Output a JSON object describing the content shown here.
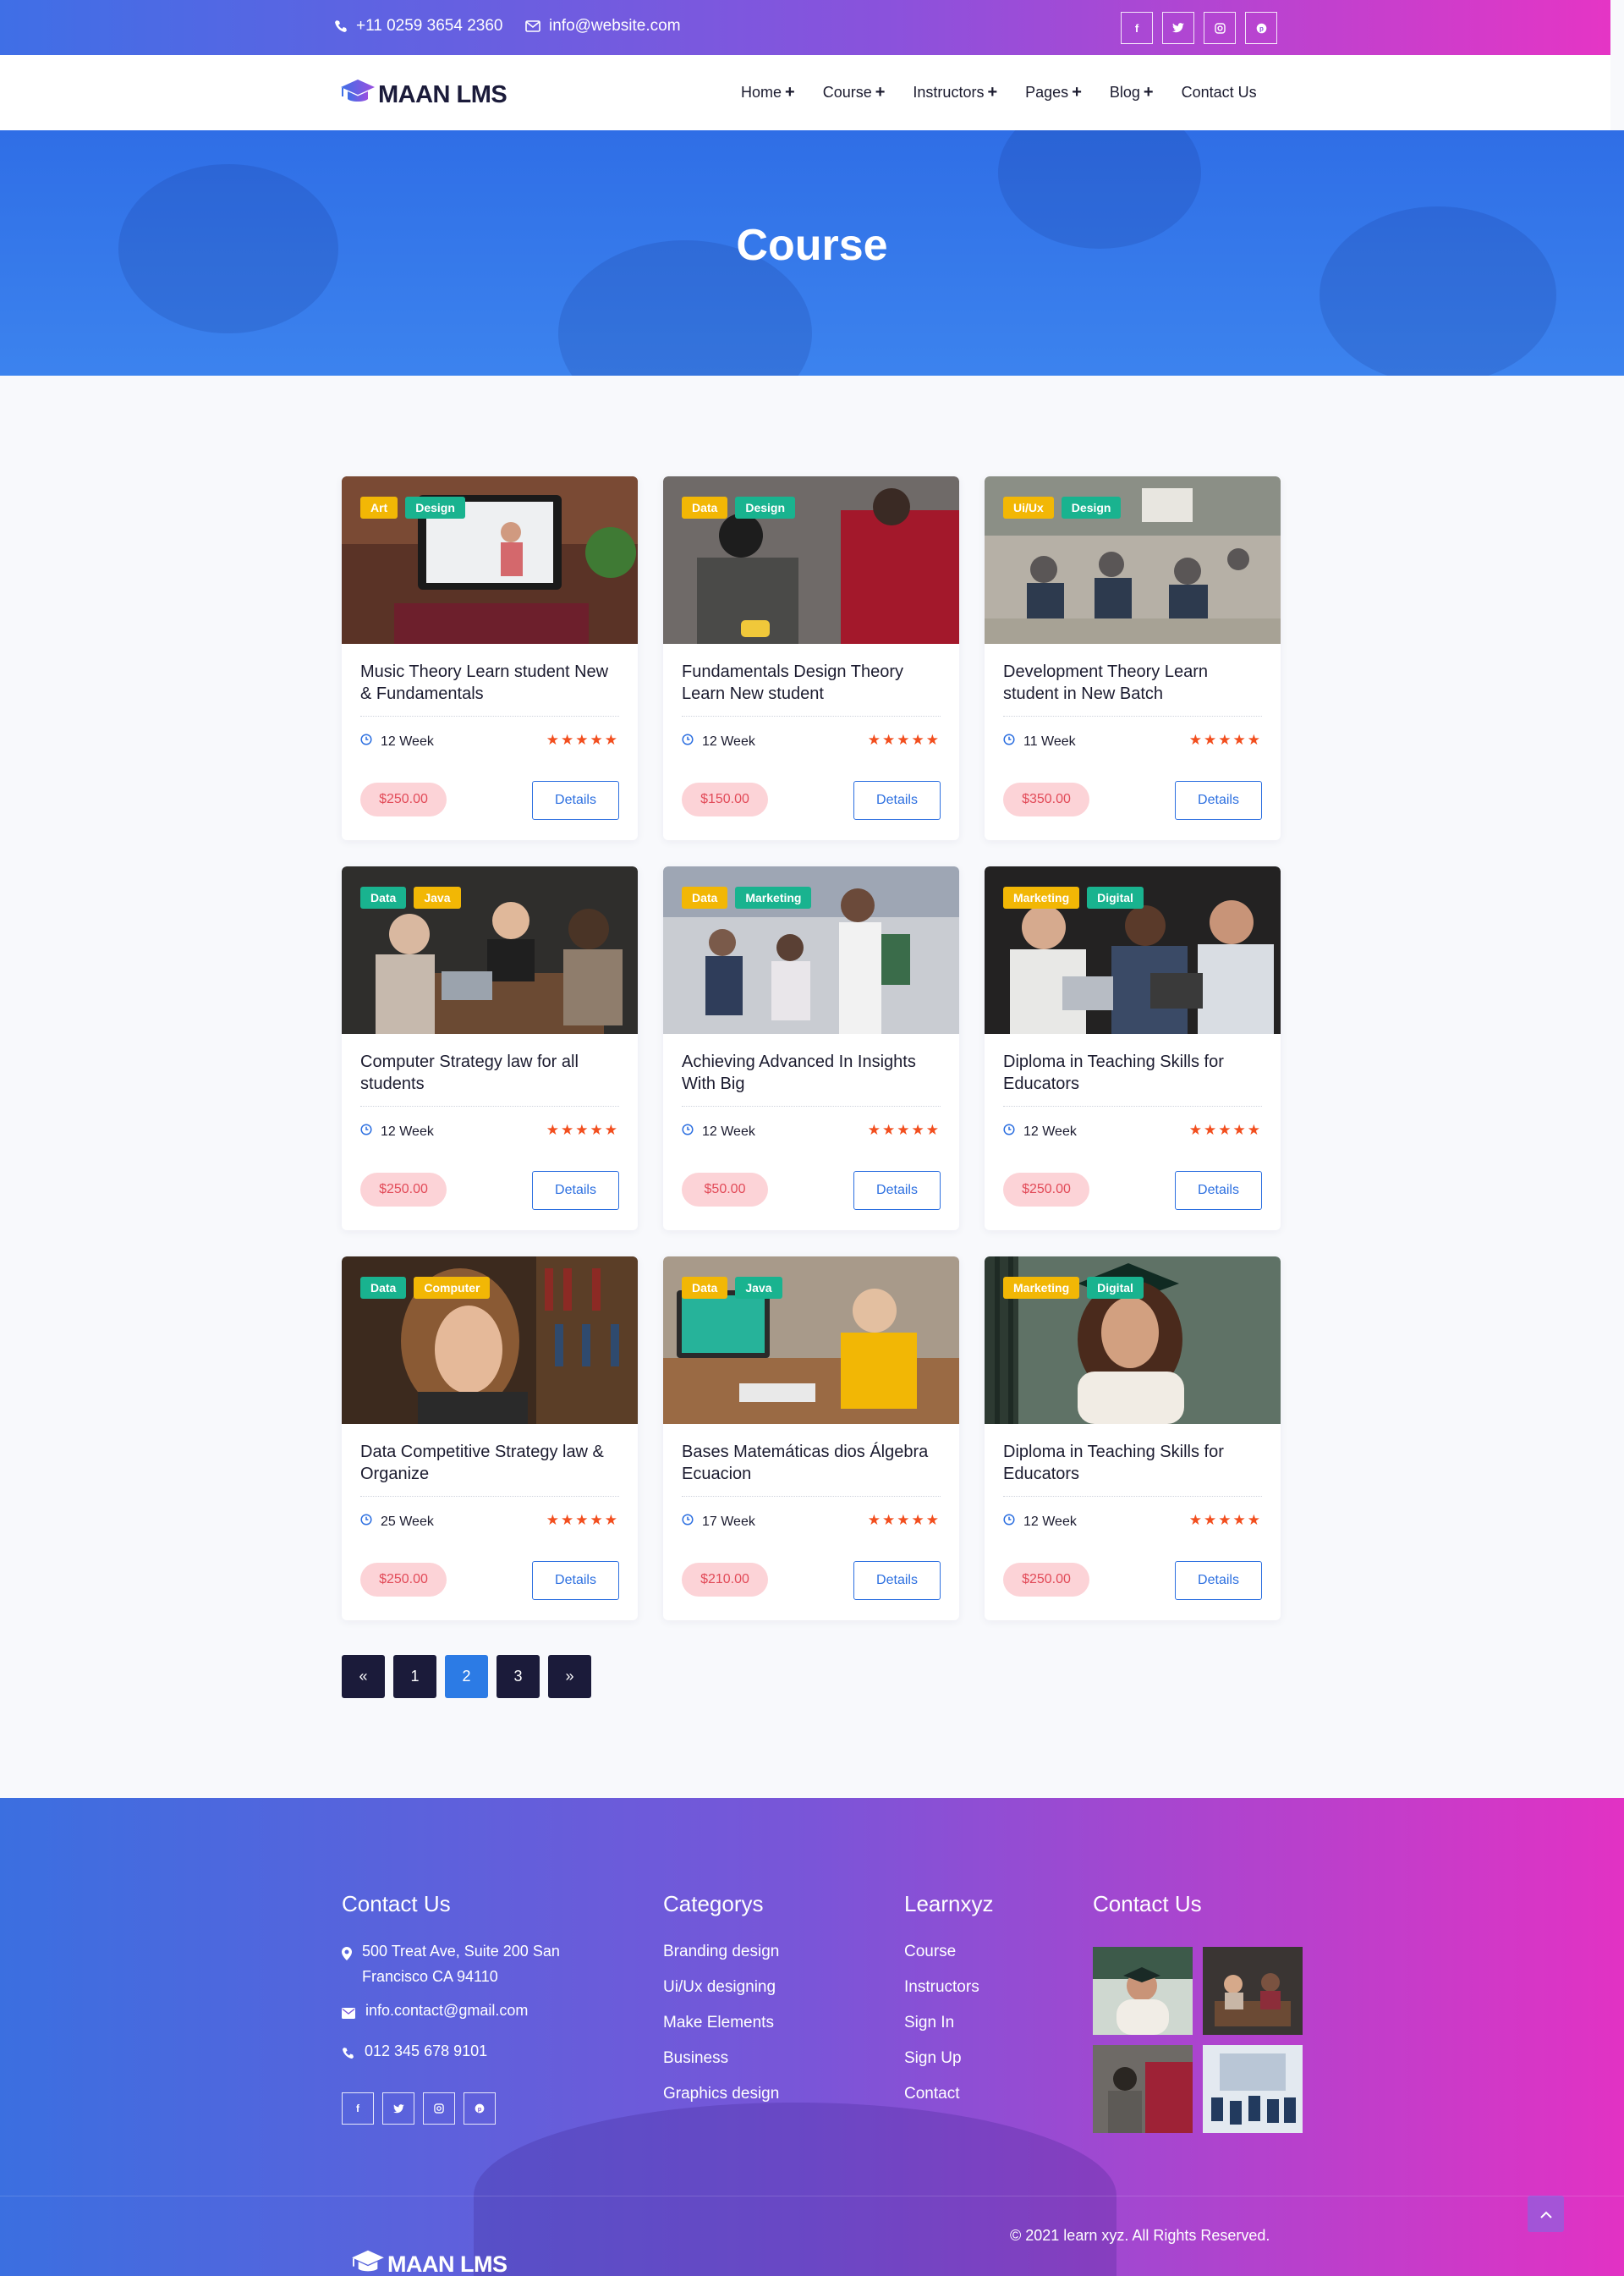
{
  "topbar": {
    "phone": "+11 0259 3654 2360",
    "email": "info@website.com",
    "socials": [
      "f",
      "t",
      "in",
      "p"
    ]
  },
  "brand": {
    "name": "MAAN LMS"
  },
  "nav": [
    {
      "label": "Home",
      "has_submenu": true
    },
    {
      "label": "Course",
      "has_submenu": true
    },
    {
      "label": "Instructors",
      "has_submenu": true
    },
    {
      "label": "Pages",
      "has_submenu": true
    },
    {
      "label": "Blog",
      "has_submenu": true
    },
    {
      "label": "Contact Us",
      "has_submenu": false
    }
  ],
  "hero": {
    "title": "Course"
  },
  "courses": [
    {
      "tags": [
        "Art",
        "Design"
      ],
      "title": "Music Theory Learn student New & Fundamentals",
      "duration": "12 Week",
      "rating": 5,
      "price": "$250.00",
      "details": "Details"
    },
    {
      "tags": [
        "Data",
        "Design"
      ],
      "title": "Fundamentals Design Theory Learn New student",
      "duration": "12 Week",
      "rating": 5,
      "price": "$150.00",
      "details": "Details"
    },
    {
      "tags": [
        "Ui/Ux",
        "Design"
      ],
      "title": "Development Theory Learn student in New Batch",
      "duration": "11 Week",
      "rating": 5,
      "price": "$350.00",
      "details": "Details"
    },
    {
      "tags": [
        "Data",
        "Java"
      ],
      "title": "Computer Strategy law for all students",
      "duration": "12 Week",
      "rating": 5,
      "price": "$250.00",
      "details": "Details"
    },
    {
      "tags": [
        "Data",
        "Marketing"
      ],
      "title": "Achieving Advanced In Insights With Big",
      "duration": "12 Week",
      "rating": 5,
      "price": "$50.00",
      "details": "Details"
    },
    {
      "tags": [
        "Marketing",
        "Digital"
      ],
      "title": "Diploma in Teaching Skills for Educators",
      "duration": "12 Week",
      "rating": 5,
      "price": "$250.00",
      "details": "Details"
    },
    {
      "tags": [
        "Data",
        "Computer"
      ],
      "title": "Data Competitive Strategy law & Organize",
      "duration": "25 Week",
      "rating": 5,
      "price": "$250.00",
      "details": "Details"
    },
    {
      "tags": [
        "Data",
        "Java"
      ],
      "title": "Bases Matemáticas dios Álgebra Ecuacion",
      "duration": "17 Week",
      "rating": 5,
      "price": "$210.00",
      "details": "Details"
    },
    {
      "tags": [
        "Marketing",
        "Digital"
      ],
      "title": "Diploma in Teaching Skills for Educators",
      "duration": "12 Week",
      "rating": 5,
      "price": "$250.00",
      "details": "Details"
    }
  ],
  "pagination": {
    "prev": "«",
    "pages": [
      "1",
      "2",
      "3"
    ],
    "current": "2",
    "next": "»"
  },
  "footer": {
    "contact": {
      "heading": "Contact Us",
      "address": "500 Treat Ave, Suite 200 San Francisco CA 94110",
      "email": "info.contact@gmail.com",
      "phone": "012 345 678 9101"
    },
    "categories": {
      "heading": "Categorys",
      "items": [
        "Branding design",
        "Ui/Ux designing",
        "Make Elements",
        "Business",
        "Graphics design"
      ]
    },
    "links": {
      "heading": "Learnxyz",
      "items": [
        "Course",
        "Instructors",
        "Sign In",
        "Sign Up",
        "Contact"
      ]
    },
    "gallery": {
      "heading": "Contact Us"
    },
    "copyright": "© 2021 learn xyz. All Rights Reserved."
  },
  "colors": {
    "primary": "#2c7be5",
    "accent_pink": "#e535c5",
    "star": "#f24e1e",
    "price_bg": "#fcd3d7",
    "tag_yellow": "#f2b705",
    "tag_green": "#19b38f"
  }
}
